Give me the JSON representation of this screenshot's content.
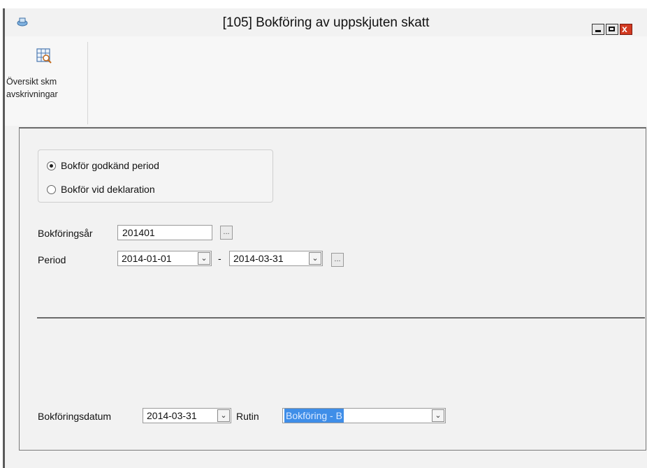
{
  "window": {
    "title": "[105]  Bokföring av uppskjuten skatt",
    "controls": {
      "minimize_glyph": "",
      "maximize_glyph": "",
      "close_glyph": "x"
    }
  },
  "toolbar": {
    "buttons": [
      {
        "label_line1": "Översikt skm",
        "label_line2": "avskrivningar",
        "icon": "table-preview-icon"
      }
    ]
  },
  "form": {
    "mode_options": [
      {
        "label": "Bokför godkänd period",
        "selected": true
      },
      {
        "label": "Bokför vid deklaration",
        "selected": false
      }
    ],
    "bokforingsar": {
      "label": "Bokföringsår",
      "value": "201401",
      "browse": "..."
    },
    "period": {
      "label": "Period",
      "from": "2014-01-01",
      "separator": "-",
      "to": "2014-03-31",
      "browse": "..."
    },
    "bokforingsdatum": {
      "label": "Bokföringsdatum",
      "value": "2014-03-31"
    },
    "rutin": {
      "label": "Rutin",
      "value": "Bokföring - B"
    },
    "dropdown_arrow": "⌄"
  },
  "colors": {
    "selection": "#3f8ee8",
    "close_button": "#d23a21"
  }
}
